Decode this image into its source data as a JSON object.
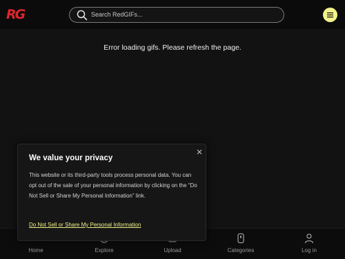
{
  "header": {
    "logo": "RG",
    "search_placeholder": "Search RedGIFs..."
  },
  "main": {
    "error": "Error loading gifs. Please refresh the page."
  },
  "nav": {
    "items": [
      {
        "label": "Home",
        "icon": "home-icon"
      },
      {
        "label": "Explore",
        "icon": "explore-icon"
      },
      {
        "label": "Upload",
        "icon": "upload-icon"
      },
      {
        "label": "Categories",
        "icon": "categories-icon"
      },
      {
        "label": "Log in",
        "icon": "user-icon"
      }
    ]
  },
  "consent": {
    "title": "We value your privacy",
    "body": "This website or its third-party tools process personal data. You can opt out of the sale of your personal information by clicking on the “Do Not Sell or Share My Personal Information” link.",
    "link": "Do Not Sell or Share My Personal Information"
  },
  "colors": {
    "brand": "#e0252b",
    "accent": "#f2f28a",
    "background": "#121212"
  }
}
